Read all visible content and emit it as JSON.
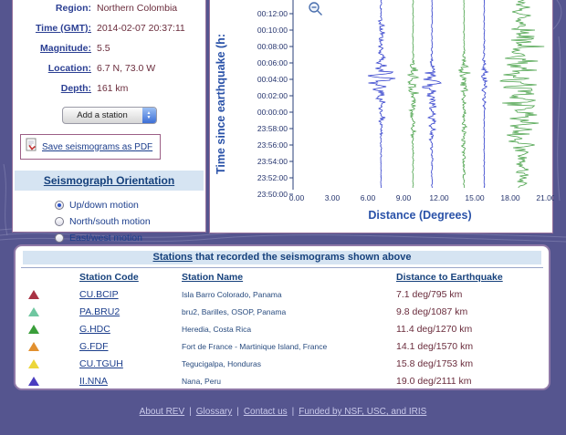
{
  "event": {
    "region_label": "Region:",
    "region_value": "Northern Colombia",
    "time_label": "Time (GMT):",
    "time_value": "2014-02-07 20:37:11",
    "magnitude_label": "Magnitude:",
    "magnitude_value": "5.5",
    "location_label": "Location:",
    "location_value": "6.7 N, 73.0 W",
    "depth_label": "Depth:",
    "depth_value": "161 km"
  },
  "controls": {
    "add_station_label": "Add a station",
    "save_pdf_label": "Save seismograms as PDF",
    "orientation_title": "Seismograph Orientation",
    "orientations": [
      {
        "label": "Up/down motion",
        "selected": true
      },
      {
        "label": "North/south motion",
        "selected": false
      },
      {
        "label": "East/west motion",
        "selected": false
      }
    ]
  },
  "chart_data": {
    "type": "line",
    "subtype": "seismogram-record-section",
    "xlabel": "Distance (Degrees)",
    "ylabel": "Time since earthquake (h:",
    "x_ticks": [
      "0.00",
      "3.00",
      "6.00",
      "9.00",
      "12.00",
      "15.00",
      "18.00",
      "21.00"
    ],
    "y_ticks": [
      "00:12:00",
      "00:10:00",
      "00:08:00",
      "00:06:00",
      "00:04:00",
      "00:02:00",
      "00:00:00",
      "23:58:00",
      "23:56:00",
      "23:54:00",
      "23:52:00",
      "23:50:00"
    ],
    "x_range_deg": [
      0,
      21
    ],
    "traces": [
      {
        "station": "CU.BCIP",
        "distance_deg": 7.1,
        "color": "#2433c8",
        "base": 0.7,
        "bursts": [
          {
            "t": 0.2,
            "s": 0.06,
            "a": 4
          },
          {
            "t": 0.42,
            "s": 0.055,
            "a": 14
          },
          {
            "t": 0.56,
            "s": 0.09,
            "a": 6
          }
        ]
      },
      {
        "station": "PA.BRU2",
        "distance_deg": 9.8,
        "color": "#3f9c3f",
        "base": 0.7,
        "bursts": [
          {
            "t": 0.44,
            "s": 0.05,
            "a": 8
          },
          {
            "t": 0.6,
            "s": 0.1,
            "a": 4
          }
        ]
      },
      {
        "station": "G.HDC",
        "distance_deg": 11.4,
        "color": "#2433c8",
        "base": 0.7,
        "bursts": [
          {
            "t": 0.44,
            "s": 0.05,
            "a": 10
          },
          {
            "t": 0.62,
            "s": 0.12,
            "a": 5
          }
        ]
      },
      {
        "station": "G.FDF",
        "distance_deg": 14.1,
        "color": "#3f9c3f",
        "base": 0.7,
        "bursts": [
          {
            "t": 0.42,
            "s": 0.06,
            "a": 6
          },
          {
            "t": 0.7,
            "s": 0.15,
            "a": 3
          }
        ]
      },
      {
        "station": "CU.TGUH",
        "distance_deg": 15.8,
        "color": "#2433c8",
        "base": 0.7,
        "bursts": [
          {
            "t": 0.45,
            "s": 0.07,
            "a": 5
          }
        ]
      },
      {
        "station": "II.NNA",
        "distance_deg": 19.0,
        "color": "#3f9c3f",
        "base": 2.0,
        "bursts": [
          {
            "t": 0.35,
            "s": 0.22,
            "a": 20
          },
          {
            "t": 0.7,
            "s": 0.18,
            "a": 13
          }
        ]
      }
    ]
  },
  "stations_table": {
    "title_link": "Stations",
    "title_rest": " that recorded the seismograms shown above",
    "headers": [
      "Station Code",
      "Station Name",
      "Distance to Earthquake"
    ],
    "rows": [
      {
        "marker_color": "#a93244",
        "code": "CU.BCIP",
        "name": "Isla Barro Colorado, Panama",
        "distance": "7.1 deg/795 km"
      },
      {
        "marker_color": "#6fc7a0",
        "code": "PA.BRU2",
        "name": "bru2, Barilles, OSOP, Panama",
        "distance": "9.8 deg/1087 km"
      },
      {
        "marker_color": "#3a9e3a",
        "code": "G.HDC",
        "name": "Heredia, Costa Rica",
        "distance": "11.4 deg/1270 km"
      },
      {
        "marker_color": "#e2902e",
        "code": "G.FDF",
        "name": "Fort de France - Martinique Island, France",
        "distance": "14.1 deg/1570 km"
      },
      {
        "marker_color": "#ecd63a",
        "code": "CU.TGUH",
        "name": "Tegucigalpa, Honduras",
        "distance": "15.8 deg/1753 km"
      },
      {
        "marker_color": "#4a3cc0",
        "code": "II.NNA",
        "name": "Nana, Peru",
        "distance": "19.0 deg/2111 km"
      }
    ]
  },
  "footer": {
    "separator": "|",
    "links": [
      "About REV",
      "Glossary",
      "Contact us",
      "Funded by NSF, USC, and IRIS"
    ]
  }
}
